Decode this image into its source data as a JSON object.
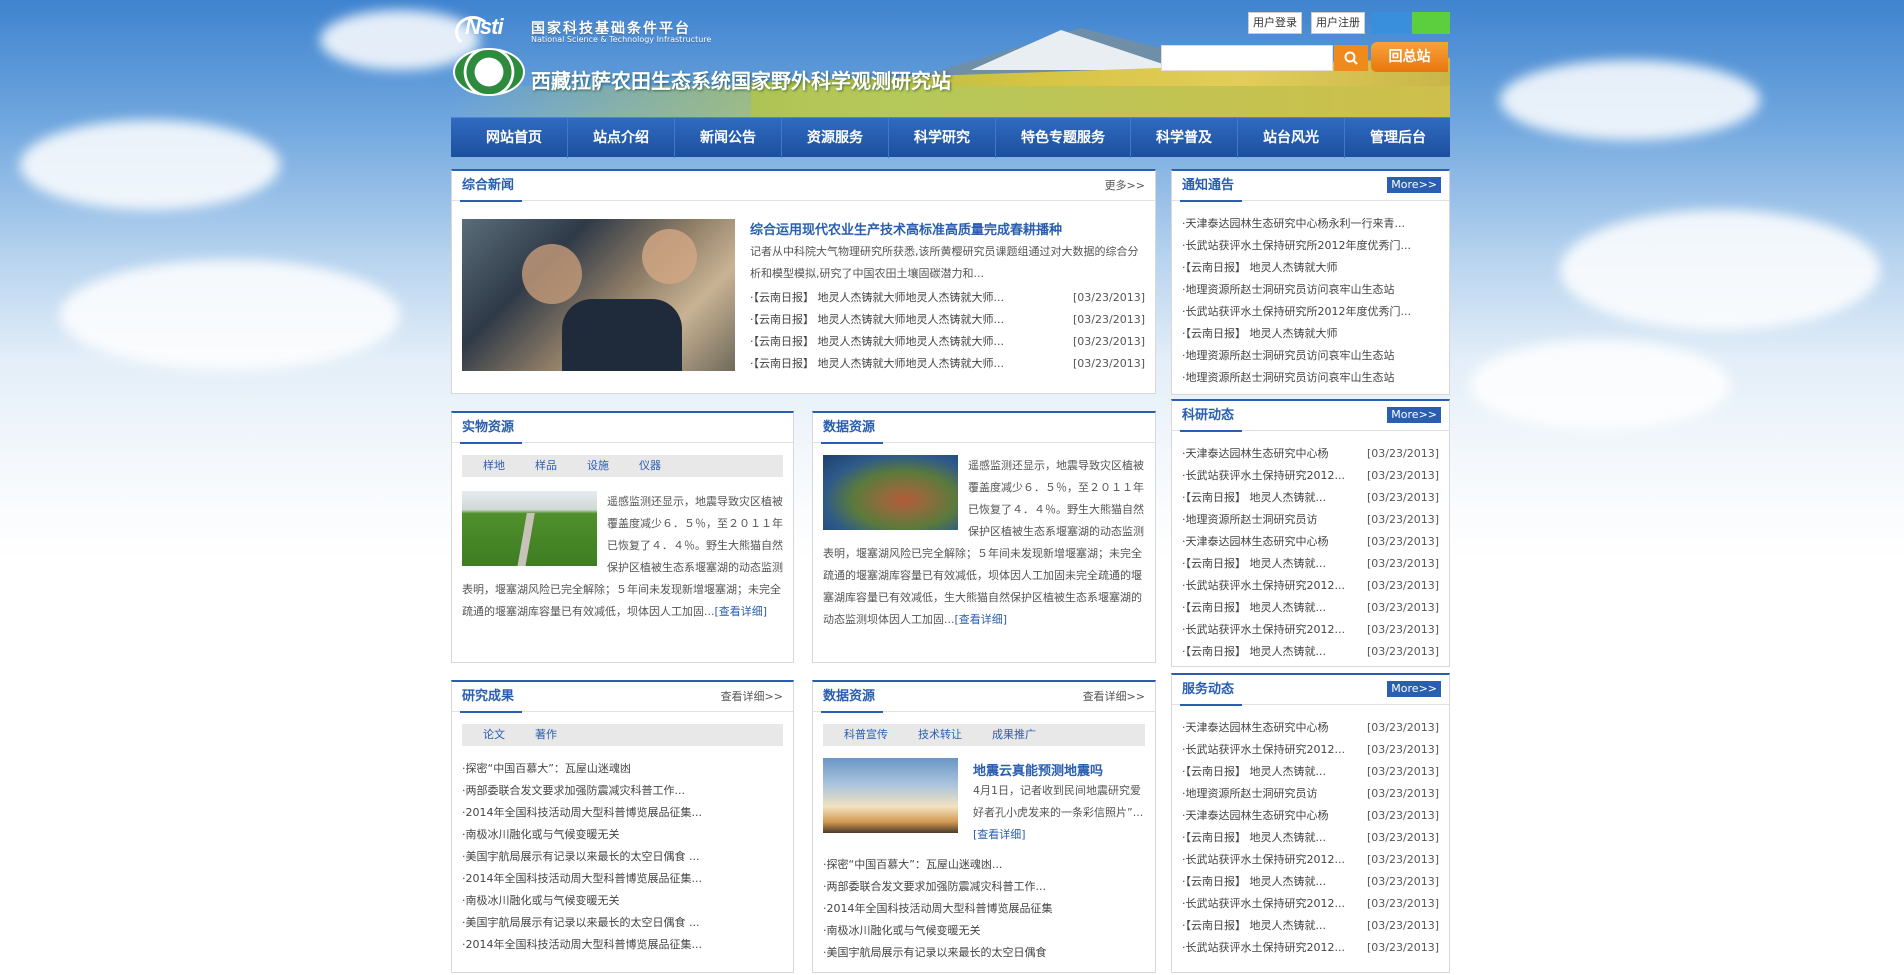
{
  "header": {
    "platform_cn": "国家科技基础条件平台",
    "platform_en": "National Science & Technology Infrastructure",
    "station_title": "西藏拉萨农田生态系统国家野外科学观测研究站",
    "login": "用户登录",
    "register": "用户注册",
    "search_placeholder": "",
    "home_button": "回总站",
    "colors": {
      "swatch1": "#3a8fdc",
      "swatch2": "#5ccf3f",
      "search_btn": "#f08a1c"
    }
  },
  "nav": [
    "网站首页",
    "站点介绍",
    "新闻公告",
    "资源服务",
    "科学研究",
    "特色专题服务",
    "科学普及",
    "站台风光",
    "管理后台"
  ],
  "news": {
    "title": "综合新闻",
    "more": "更多>>",
    "headline": "综合运用现代农业生产技术高标准高质量完成春耕播种",
    "summary": "记者从中科院大气物理研究所获悉,该所黄樱研究员课题组通过对大数据的综合分析和模型模拟,研究了中国农田土壤固碳潜力和...",
    "items": [
      {
        "text": "·【云南日报】 地灵人杰铸就大师地灵人杰铸就大师...",
        "date": "[03/23/2013]"
      },
      {
        "text": "·【云南日报】 地灵人杰铸就大师地灵人杰铸就大师...",
        "date": "[03/23/2013]"
      },
      {
        "text": "·【云南日报】 地灵人杰铸就大师地灵人杰铸就大师...",
        "date": "[03/23/2013]"
      },
      {
        "text": "·【云南日报】 地灵人杰铸就大师地灵人杰铸就大师...",
        "date": "[03/23/2013]"
      }
    ]
  },
  "physical": {
    "title": "实物资源",
    "tabs": [
      "样地",
      "样品",
      "设施",
      "仪器"
    ],
    "text": "遥感监测还显示，地震导致灾区植被覆盖度减少６．５％，至２０１１年已恢复了４．４％。野生大熊猫自然保护区植被生态系堰塞湖的动态监测表明，堰塞湖风险已完全解除；５年间未发现新增堰塞湖；未完全疏通的堰塞湖库容量已有效减低，坝体因人工加固...",
    "detail": "[查看详细]"
  },
  "data_res": {
    "title": "数据资源",
    "text": "遥感监测还显示，地震导致灾区植被覆盖度减少６．５％，至２０１１年已恢复了４．４％。野生大熊猫自然保护区植被生态系堰塞湖的动态监测表明，堰塞湖风险已完全解除；５年间未发现新增堰塞湖；未完全疏通的堰塞湖库容量已有效减低，坝体因人工加固未完全疏通的堰塞湖库容量已有效减低，生大熊猫自然保护区植被生态系堰塞湖的动态监测坝体因人工加固...",
    "detail": "[查看详细]"
  },
  "results": {
    "title": "研究成果",
    "more": "查看详细>>",
    "tabs": [
      "论文",
      "著作"
    ],
    "items": [
      "·探密“中国百慕大”：瓦屋山迷魂凼",
      "·两部委联合发文要求加强防震减灾科普工作...",
      "·2014年全国科技活动周大型科普博览展品征集...",
      "·南极冰川融化或与气候变暖无关",
      "·美国宇航局展示有记录以来最长的太空日偶食 ...",
      "·2014年全国科技活动周大型科普博览展品征集...",
      "·南极冰川融化或与气候变暖无关",
      "·美国宇航局展示有记录以来最长的太空日偶食 ...",
      "·2014年全国科技活动周大型科普博览展品征集..."
    ]
  },
  "data_res2": {
    "title": "数据资源",
    "more": "查看详细>>",
    "tabs": [
      "科普宣传",
      "技术转让",
      "成果推广"
    ],
    "headline": "地震云真能预测地震吗",
    "summary": "4月1日，记者收到民间地震研究爱好者孔小虎发来的一条彩信照片”...",
    "detail": "[查看详细]",
    "items": [
      "·探密“中国百慕大”：瓦屋山迷魂凼...",
      "·两部委联合发文要求加强防震减灾科普工作...",
      "·2014年全国科技活动周大型科普博览展品征集",
      "·南极冰川融化或与气候变暖无关",
      "·美国宇航局展示有记录以来最长的太空日偶食"
    ]
  },
  "notice": {
    "title": "通知通告",
    "more": "More>>",
    "items": [
      "·天津泰达园林生态研究中心杨永利一行来青...",
      "·长武站获评水土保持研究所2012年度优秀门...",
      "·【云南日报】 地灵人杰铸就大师",
      "·地理资源所赵士洞研究员访问哀牢山生态站",
      "·长武站获评水土保持研究所2012年度优秀门...",
      "·【云南日报】 地灵人杰铸就大师",
      "·地理资源所赵士洞研究员访问哀牢山生态站",
      "·地理资源所赵士洞研究员访问哀牢山生态站"
    ]
  },
  "research": {
    "title": "科研动态",
    "more": "More>>",
    "items": [
      {
        "text": "·天津泰达园林生态研究中心杨",
        "date": "[03/23/2013]"
      },
      {
        "text": "·长武站获评水土保持研究2012...",
        "date": "[03/23/2013]"
      },
      {
        "text": "·【云南日报】 地灵人杰铸就...",
        "date": "[03/23/2013]"
      },
      {
        "text": "·地理资源所赵士洞研究员访",
        "date": "[03/23/2013]"
      },
      {
        "text": "·天津泰达园林生态研究中心杨",
        "date": "[03/23/2013]"
      },
      {
        "text": "·【云南日报】 地灵人杰铸就...",
        "date": "[03/23/2013]"
      },
      {
        "text": "·长武站获评水土保持研究2012...",
        "date": "[03/23/2013]"
      },
      {
        "text": "·【云南日报】 地灵人杰铸就...",
        "date": "[03/23/2013]"
      },
      {
        "text": "·长武站获评水土保持研究2012...",
        "date": "[03/23/2013]"
      },
      {
        "text": "·【云南日报】 地灵人杰铸就...",
        "date": "[03/23/2013]"
      }
    ]
  },
  "service": {
    "title": "服务动态",
    "more": "More>>",
    "items": [
      {
        "text": "·天津泰达园林生态研究中心杨",
        "date": "[03/23/2013]"
      },
      {
        "text": "·长武站获评水土保持研究2012...",
        "date": "[03/23/2013]"
      },
      {
        "text": "·【云南日报】 地灵人杰铸就...",
        "date": "[03/23/2013]"
      },
      {
        "text": "·地理资源所赵士洞研究员访",
        "date": "[03/23/2013]"
      },
      {
        "text": "·天津泰达园林生态研究中心杨",
        "date": "[03/23/2013]"
      },
      {
        "text": "·【云南日报】 地灵人杰铸就...",
        "date": "[03/23/2013]"
      },
      {
        "text": "·长武站获评水土保持研究2012...",
        "date": "[03/23/2013]"
      },
      {
        "text": "·【云南日报】 地灵人杰铸就...",
        "date": "[03/23/2013]"
      },
      {
        "text": "·长武站获评水土保持研究2012...",
        "date": "[03/23/2013]"
      },
      {
        "text": "·【云南日报】 地灵人杰铸就...",
        "date": "[03/23/2013]"
      },
      {
        "text": "·长武站获评水土保持研究2012...",
        "date": "[03/23/2013]"
      }
    ]
  }
}
